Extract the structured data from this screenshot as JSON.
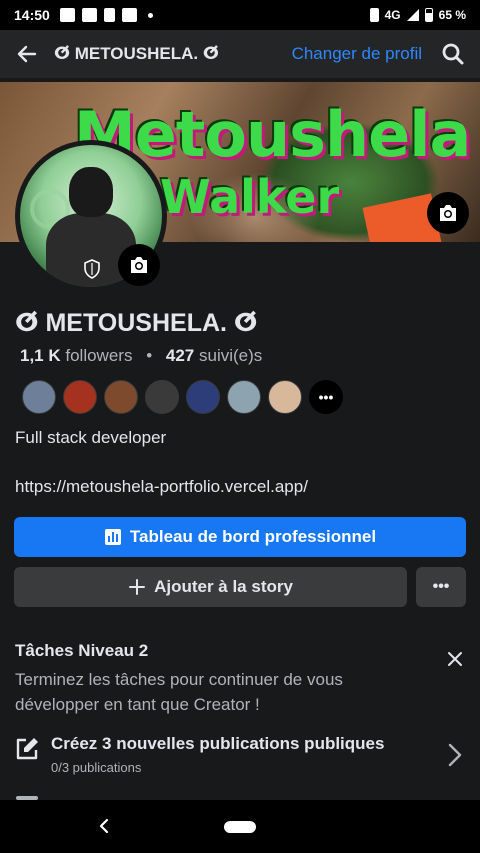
{
  "status_bar": {
    "time": "14:50",
    "network": "4G",
    "battery": "65 %",
    "battery_level": 0.65
  },
  "app_bar": {
    "back_icon": "arrow-left-icon",
    "title": "ⵚ METOUSHELA. ⵚ",
    "switch_profile": "Changer de profil",
    "search_icon": "search-icon"
  },
  "cover": {
    "line1": "Metoushela",
    "line2": "Walker",
    "camera_icon": "camera-icon"
  },
  "profile": {
    "name": "ⵚ METOUSHELA. ⵚ",
    "followers_count": "1,1 K",
    "followers_label": "followers",
    "following_count": "427",
    "following_label": "suivi(e)s",
    "friends_more": "•••",
    "bio": "Full stack developer",
    "link": "https://metoushela-portfolio.vercel.app/"
  },
  "friend_colors": [
    "#6d7f99",
    "#a5321f",
    "#7d4a2e",
    "#3a3a3a",
    "#2c3d7a",
    "#8da3b0",
    "#d8b89a"
  ],
  "buttons": {
    "dashboard": "Tableau de bord professionnel",
    "add_story": "Ajouter à la story",
    "more": "•••"
  },
  "tasks": {
    "title": "Tâches Niveau 2",
    "description": "Terminez les tâches pour continuer de vous développer en tant que Creator !",
    "items": [
      {
        "title": "Créez 3 nouvelles publications publiques",
        "subtitle": "0/3 publications"
      }
    ]
  },
  "colors": {
    "accent": "#1877f2",
    "link": "#2d88ff",
    "background": "#18191a",
    "surface": "#3a3b3c"
  }
}
